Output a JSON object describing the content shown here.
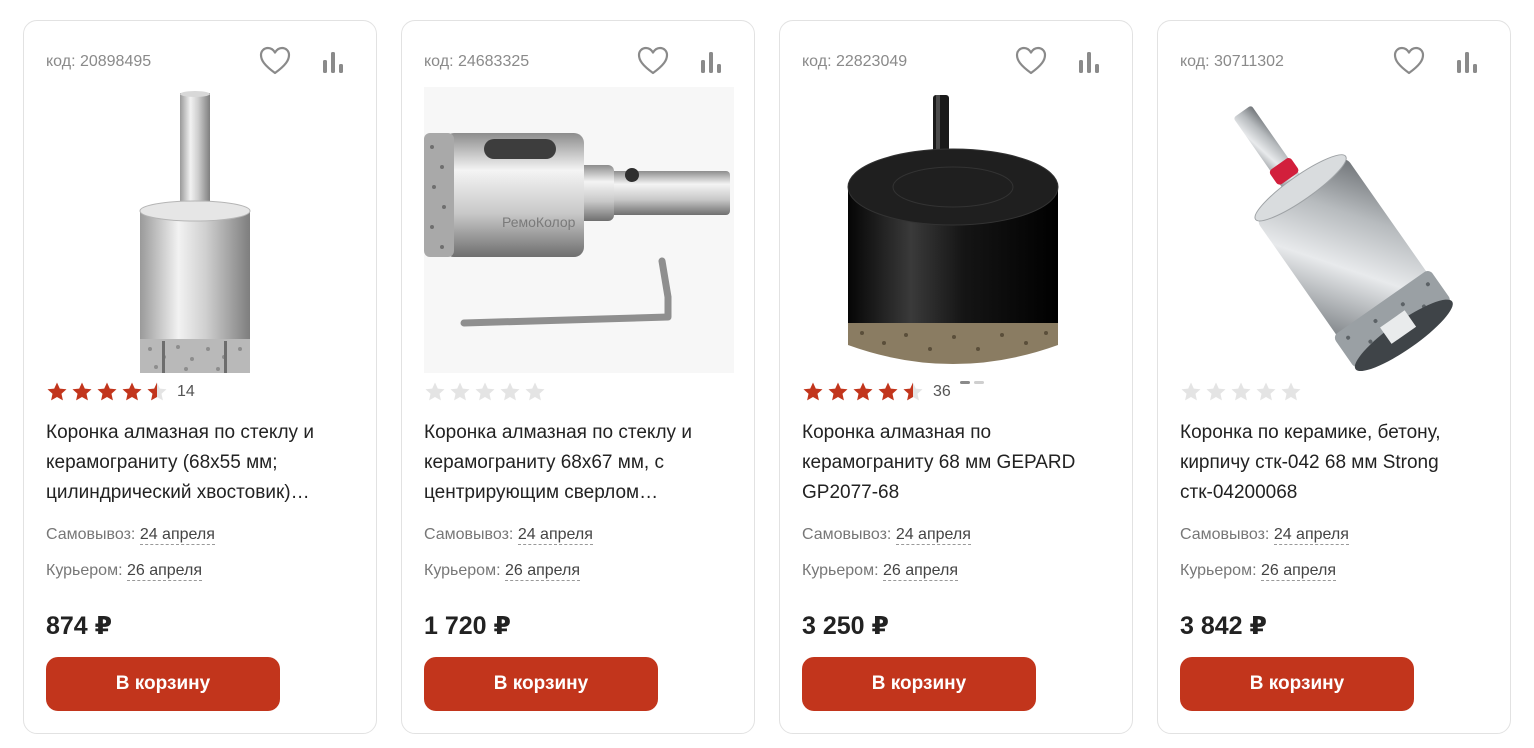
{
  "colors": {
    "accent": "#c2351c",
    "star_on": "#c2351c",
    "star_off": "#e4e4e4"
  },
  "cart_label": "В корзину",
  "pickup_label": "Самовывоз:",
  "courier_label": "Курьером:",
  "products": [
    {
      "code": "код: 20898495",
      "rating": 4.5,
      "reviews": "14",
      "title": "Коронка алмазная по стеклу и керамограниту (68x55 мм; цилиндрический хвостовик)…",
      "pickup_date": "24 апреля",
      "courier_date": "26 апреля",
      "price": "874 ₽",
      "image_icon": "diamond-core-bit-glass-icon"
    },
    {
      "code": "код: 24683325",
      "rating": 0,
      "reviews": "",
      "title": "Коронка алмазная по стеклу и керамограниту 68х67 мм, с центрирующим сверлом…",
      "pickup_date": "24 апреля",
      "courier_date": "26 апреля",
      "price": "1 720 ₽",
      "image_icon": "diamond-core-bit-with-hex-key-icon",
      "image_brand_text": "РемоКолор"
    },
    {
      "code": "код: 22823049",
      "rating": 4.5,
      "reviews": "36",
      "title": "Коронка алмазная по керамограниту 68 мм GEPARD GP2077-68",
      "pickup_date": "24 апреля",
      "courier_date": "26 апреля",
      "price": "3 250 ₽",
      "image_icon": "black-diamond-core-bit-icon"
    },
    {
      "code": "код: 30711302",
      "rating": 0,
      "reviews": "",
      "title": "Коронка по керамике, бетону, кирпичу стк-042 68 мм Strong стк-04200068",
      "pickup_date": "24 апреля",
      "courier_date": "26 апреля",
      "price": "3 842 ₽",
      "image_icon": "ceramic-core-bit-icon"
    }
  ]
}
